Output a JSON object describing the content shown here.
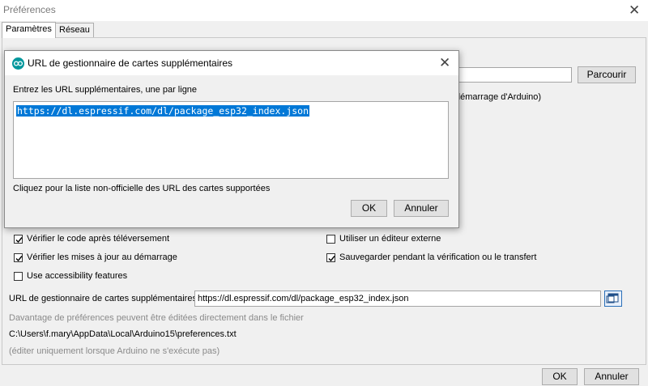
{
  "window": {
    "title": "Préférences",
    "close_glyph": "✕"
  },
  "tabs": [
    {
      "label": "Paramètres",
      "active": true
    },
    {
      "label": "Réseau",
      "active": false
    }
  ],
  "main": {
    "browse_label": "Parcourir",
    "startup_text_fragment": "démarrage d'Arduino)",
    "checkboxes": {
      "verify_code": {
        "label": "Vérifier le code après téléversement",
        "checked": true
      },
      "check_updates": {
        "label": "Vérifier les mises à jour au démarrage",
        "checked": true
      },
      "accessibility": {
        "label": "Use accessibility features",
        "checked": false
      },
      "external_editor": {
        "label": "Utiliser un éditeur externe",
        "checked": false
      },
      "save_on_verify": {
        "label": "Sauvegarder pendant la vérification ou le transfert",
        "checked": true
      }
    },
    "board_urls_label": "URL de gestionnaire de cartes supplémentaires",
    "board_urls_value": "https://dl.espressif.com/dl/package_esp32_index.json",
    "more_prefs_text": "Davantage de préférences peuvent être éditées directement dans le fichier",
    "prefs_path": "C:\\Users\\f.mary\\AppData\\Local\\Arduino15\\preferences.txt",
    "edit_note": "(éditer uniquement lorsque Arduino ne s'exécute pas)"
  },
  "footer": {
    "ok_label": "OK",
    "cancel_label": "Annuler"
  },
  "dialog": {
    "title": "URL de gestionnaire de cartes supplémentaires",
    "close_glyph": "✕",
    "instruction": "Entrez les URL supplémentaires, une par ligne",
    "url_text": "https://dl.espressif.com/dl/package_esp32_index.json",
    "link_text": "Cliquez pour la liste non-officielle des URL des cartes supportées",
    "ok_label": "OK",
    "cancel_label": "Annuler"
  },
  "colors": {
    "selection": "#0078d7",
    "accent": "#2a6fb8",
    "arduino_teal": "#00979c"
  }
}
